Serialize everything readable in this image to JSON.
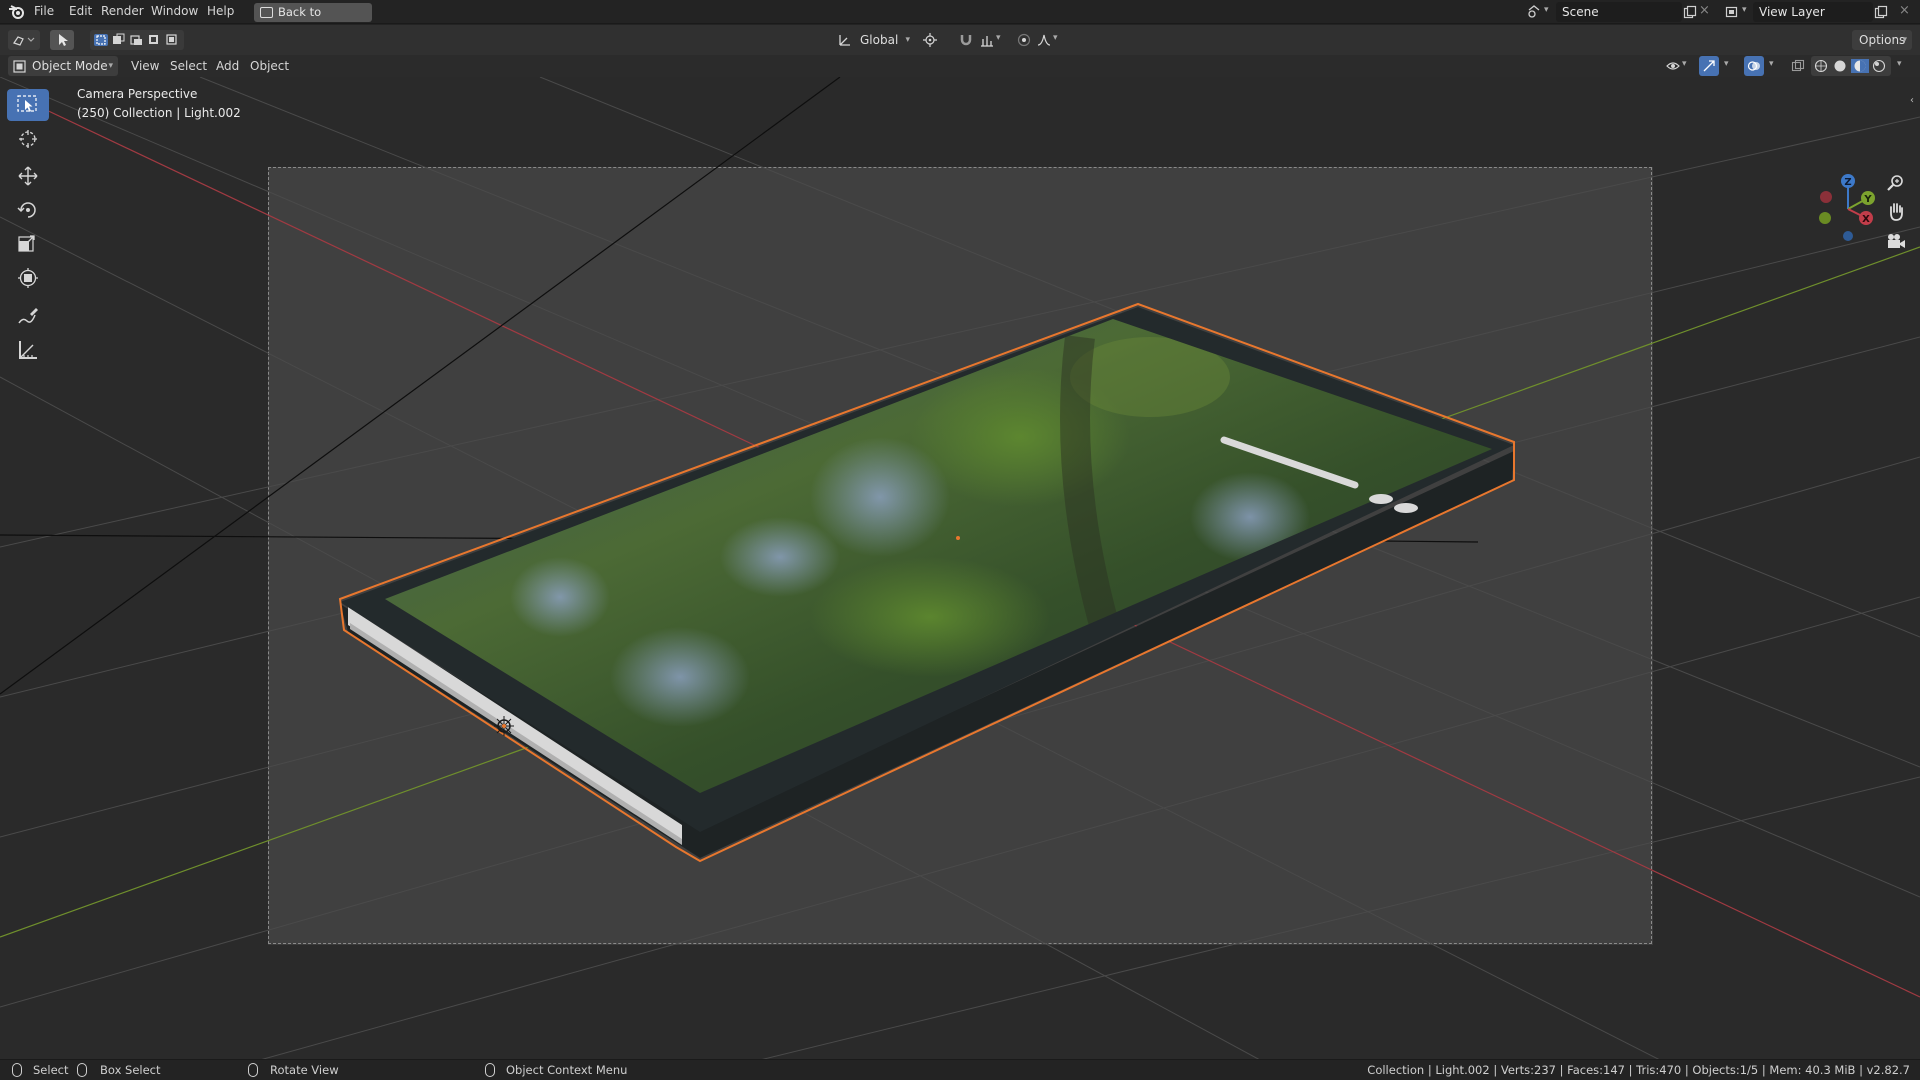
{
  "topbar": {
    "menus": [
      "File",
      "Edit",
      "Render",
      "Window",
      "Help"
    ],
    "back_button": "Back to Previous",
    "scene": "Scene",
    "view_layer": "View Layer"
  },
  "header": {
    "transform_orientation": "Global",
    "options_label": "Options",
    "mode": "Object Mode",
    "menus": [
      "View",
      "Select",
      "Add",
      "Object"
    ]
  },
  "viewport": {
    "view_name": "Camera Perspective",
    "collection_info": "(250) Collection | Light.002",
    "gizmo_axes": {
      "x": "X",
      "y": "Y",
      "z": "Z"
    }
  },
  "toolbar": {
    "tools": [
      "select-box",
      "cursor",
      "move",
      "rotate",
      "scale",
      "transform",
      "annotate",
      "measure"
    ],
    "active_tool": "select-box"
  },
  "statusbar": {
    "select": "Select",
    "box_select": "Box Select",
    "rotate_view": "Rotate View",
    "context_menu": "Object Context Menu",
    "stats": "Collection | Light.002 | Verts:237 | Faces:147 | Tris:470 | Objects:1/5 | Mem: 40.3 MiB | v2.82.7"
  },
  "colors": {
    "accent": "#4772b3",
    "selection_outline": "#e8772e",
    "x_axis": "#c23d4a",
    "y_axis": "#7ca32e",
    "z_axis": "#3d79c9"
  }
}
